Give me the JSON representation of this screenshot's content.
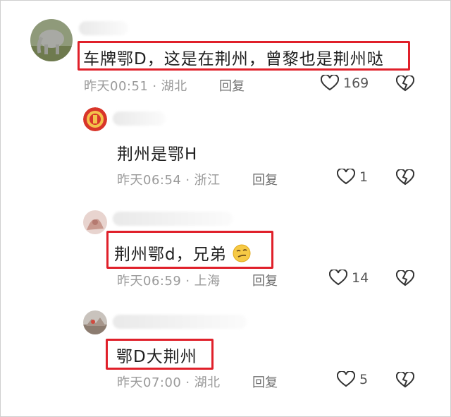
{
  "comments": [
    {
      "text": "车牌鄂D，这是在荆州，曾黎也是荆州哒",
      "time": "昨天00:51",
      "location": "湖北",
      "reply": "回复",
      "likes": "169",
      "avatar_icon": "elephant-photo-avatar"
    },
    {
      "text": "荆州是鄂H",
      "time": "昨天06:54",
      "location": "浙江",
      "reply": "回复",
      "likes": "1",
      "avatar_icon": "emblem-avatar"
    },
    {
      "text": "荆州鄂d，兄弟",
      "emoji": "smirk-emoji",
      "time": "昨天06:59",
      "location": "上海",
      "reply": "回复",
      "likes": "14",
      "avatar_icon": "hands-photo-avatar"
    },
    {
      "text": "鄂D大荆州",
      "time": "昨天07:00",
      "location": "湖北",
      "reply": "回复",
      "likes": "5",
      "avatar_icon": "landscape-photo-avatar"
    }
  ],
  "colors": {
    "highlight": "#e0202a",
    "meta": "#9a9a9a",
    "text": "#1f1f1f"
  }
}
